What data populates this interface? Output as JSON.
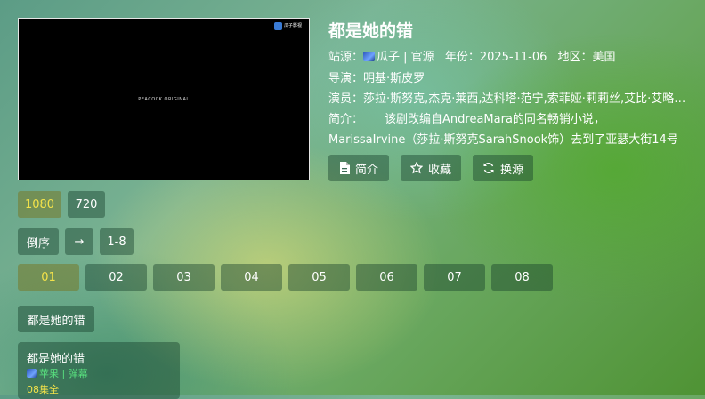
{
  "player": {
    "watermark": "PEACOCK ORIGINAL",
    "logo_text": "瓜子影视"
  },
  "detail": {
    "title": "都是她的错",
    "source_label": "站源：",
    "source_value": "瓜子 | 官源",
    "year_label": "年份：",
    "year_value": "2025-11-06",
    "region_label": "地区：",
    "region_value": "美国",
    "director_label": "导演：",
    "director_value": "明基·斯皮罗",
    "cast_label": "演员：",
    "cast_value": "莎拉·斯努克,杰克·莱西,达科塔·范宁,索菲娅·莉莉丝,艾比·艾略…",
    "intro_label": "简介：",
    "intro_line1": "该剧改编自AndreaMara的同名畅销小说，",
    "intro_line2": "MarissaIrvine（莎拉·斯努克SarahSnook饰）去到了亚瑟大街14号——"
  },
  "actions": {
    "intro": "简介",
    "favorite": "收藏",
    "switch_source": "换源"
  },
  "quality": [
    "1080",
    "720"
  ],
  "order": {
    "sort": "倒序",
    "arrow": "→",
    "range": "1-8"
  },
  "episodes": [
    "01",
    "02",
    "03",
    "04",
    "05",
    "06",
    "07",
    "08"
  ],
  "selected_episode": "01",
  "section_label": "都是她的错",
  "related": {
    "title": "都是她的错",
    "source": "苹果 | 弹幕",
    "count": "08集全"
  },
  "colors": {
    "accent": "#f3e24a",
    "source_green": "#58e07e"
  }
}
